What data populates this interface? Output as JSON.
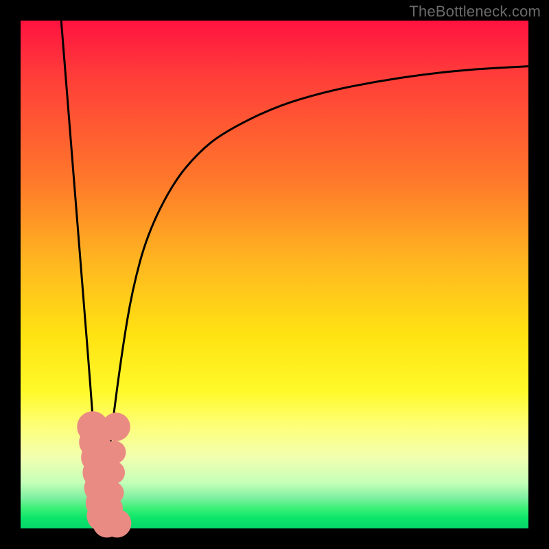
{
  "attribution": "TheBottleneck.com",
  "colors": {
    "frame": "#000000",
    "curve": "#000000",
    "marker": "#e98b83",
    "gradient_top": "#ff1240",
    "gradient_bottom": "#06d96a"
  },
  "chart_data": {
    "type": "line",
    "title": "",
    "xlabel": "",
    "ylabel": "",
    "xlim": [
      0,
      100
    ],
    "ylim": [
      0,
      100
    ],
    "grid": false,
    "legend": false,
    "note": "x and y are in percent of plot area; y counts up from bottom (0 = bottom/green, 100 = top/red). Curve reaches 0 at x≈16 (the notch).",
    "series": [
      {
        "name": "left-branch",
        "x": [
          8,
          10,
          12,
          14,
          15,
          16
        ],
        "y": [
          100,
          75,
          50,
          25,
          10,
          0
        ]
      },
      {
        "name": "right-branch",
        "x": [
          16,
          17,
          18,
          20,
          22,
          25,
          30,
          35,
          40,
          50,
          60,
          70,
          80,
          90,
          100
        ],
        "y": [
          0,
          10,
          20,
          35,
          47,
          58,
          68,
          74,
          78,
          83,
          86,
          88,
          89.5,
          90.5,
          91
        ]
      }
    ],
    "markers": {
      "name": "highlight-points",
      "note": "salmon rounded markers clustered near the notch bottom",
      "points": [
        {
          "x": 14.2,
          "y": 20,
          "r": 2.2
        },
        {
          "x": 14.6,
          "y": 17,
          "r": 2.2
        },
        {
          "x": 15.0,
          "y": 14,
          "r": 2.2
        },
        {
          "x": 15.3,
          "y": 11,
          "r": 2.2
        },
        {
          "x": 15.6,
          "y": 8,
          "r": 2.2
        },
        {
          "x": 15.9,
          "y": 5,
          "r": 2.2
        },
        {
          "x": 16.1,
          "y": 2.5,
          "r": 2.2
        },
        {
          "x": 17.0,
          "y": 1.0,
          "r": 2.0
        },
        {
          "x": 19.0,
          "y": 1.0,
          "r": 2.0
        },
        {
          "x": 18.8,
          "y": 20,
          "r": 2.0
        },
        {
          "x": 18.5,
          "y": 15,
          "r": 1.6
        },
        {
          "x": 18.3,
          "y": 11,
          "r": 1.6
        },
        {
          "x": 18.1,
          "y": 7,
          "r": 1.6
        },
        {
          "x": 17.9,
          "y": 4,
          "r": 1.6
        }
      ]
    }
  }
}
